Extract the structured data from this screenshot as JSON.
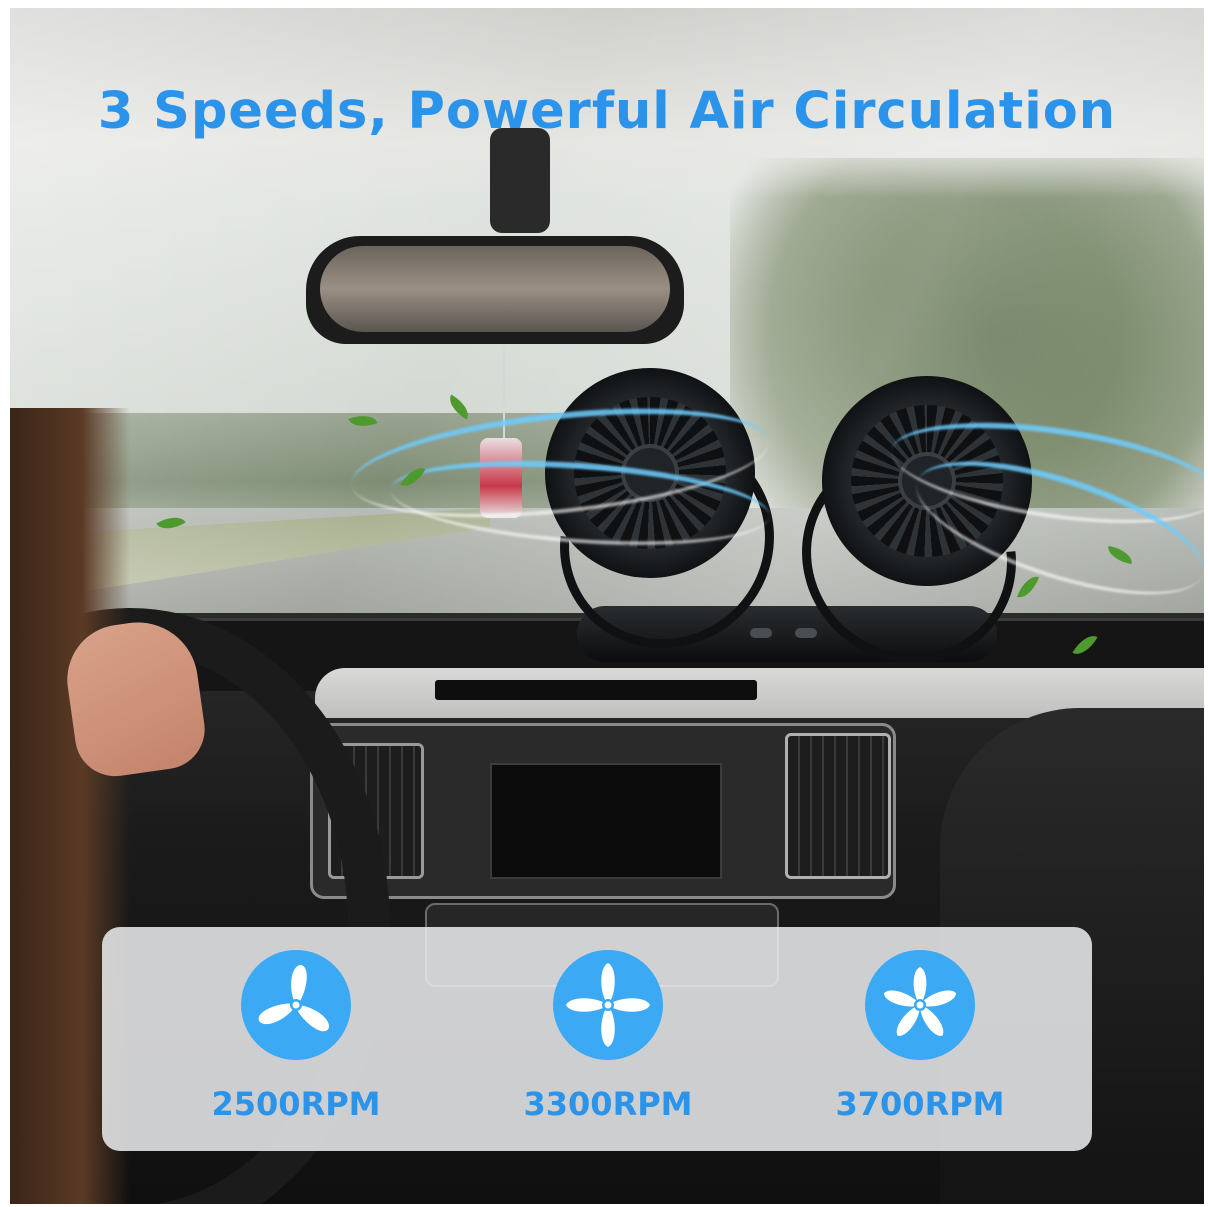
{
  "headline": "3 Speeds, Powerful Air Circulation",
  "speeds": [
    {
      "label": "2500RPM",
      "icon": "three-blade-fan-icon"
    },
    {
      "label": "3300RPM",
      "icon": "four-blade-fan-icon"
    },
    {
      "label": "3700RPM",
      "icon": "five-blade-fan-icon"
    }
  ],
  "colors": {
    "accent": "#2b94ea",
    "icon_bg": "#3ba9f3",
    "panel_bg": "#ecedf0"
  }
}
